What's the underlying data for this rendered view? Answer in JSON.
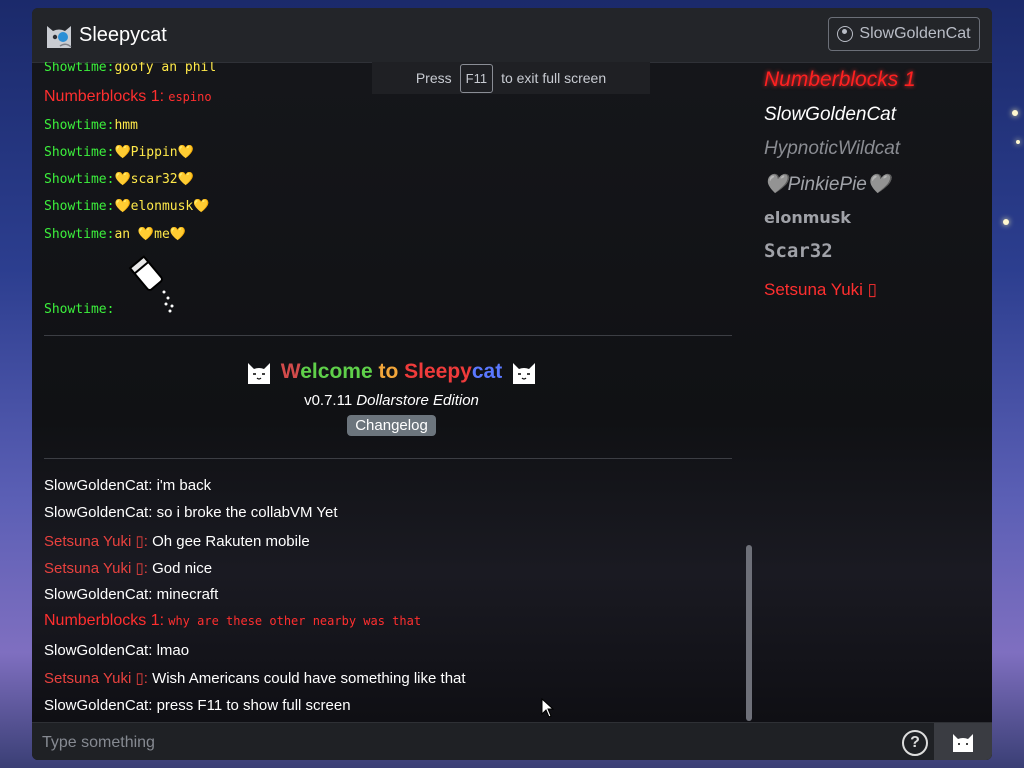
{
  "app": {
    "title": "Sleepycat"
  },
  "user_button": {
    "label": "SlowGoldenCat"
  },
  "fullscreen_tip": {
    "prefix": "Press",
    "key": "F11",
    "suffix": "to exit full screen"
  },
  "chat": {
    "top_messages": [
      {
        "name": "Showtime:",
        "text": "goofy an phil"
      },
      {
        "name": "Numberblocks 1:",
        "text": "espino"
      },
      {
        "name": "Showtime:",
        "text": "hmm"
      },
      {
        "name": "Showtime:",
        "text": "💛Pippin💛"
      },
      {
        "name": "Showtime:",
        "text": "💛scar32💛"
      },
      {
        "name": "Showtime:",
        "text": "💛elonmusk💛"
      },
      {
        "name": "Showtime:",
        "text": "an 💛me💛"
      },
      {
        "name": "Showtime:",
        "text": ""
      }
    ],
    "welcome": {
      "title_parts": [
        "W",
        "elcome",
        " to ",
        "Sleepy",
        "cat"
      ],
      "version": "v0.7.11",
      "edition": "Dollarstore Edition",
      "changelog_label": "Changelog"
    },
    "messages": [
      {
        "name": "SlowGoldenCat:",
        "text": "i'm back"
      },
      {
        "name": "SlowGoldenCat:",
        "text": "so i broke the collabVM Yet"
      },
      {
        "name": "Setsuna Yuki ▯:",
        "text": "Oh gee Rakuten mobile"
      },
      {
        "name": "Setsuna Yuki ▯:",
        "text": "God nice"
      },
      {
        "name": "SlowGoldenCat:",
        "text": "minecraft"
      },
      {
        "name": "Numberblocks 1:",
        "text": "why are these other nearby was that"
      },
      {
        "name": "SlowGoldenCat:",
        "text": "lmao"
      },
      {
        "name": "Setsuna Yuki ▯:",
        "text": "Wish Americans could have something like that"
      },
      {
        "name": "SlowGoldenCat:",
        "text": "press F11 to show full screen"
      }
    ]
  },
  "users": [
    {
      "name": "Numberblocks 1",
      "color": "#ff2020"
    },
    {
      "name": "SlowGoldenCat",
      "color": "#ffffff"
    },
    {
      "name": "HypnoticWildcat",
      "color": "#8a8c92"
    },
    {
      "name": "🩶PinkiePie🩶",
      "color": "#a0a2a8"
    },
    {
      "name": "elonmusk",
      "color": "#a0a2a8"
    },
    {
      "name": "Scar32",
      "color": "#a0a2a8"
    },
    {
      "name": "Setsuna Yuki ▯",
      "color": "#ff2f2f"
    }
  ],
  "input": {
    "placeholder": "Type something"
  },
  "icons": {
    "help": "?",
    "send": "cat-icon",
    "logo": "cat-logo-icon",
    "user": "user-circle-icon"
  }
}
